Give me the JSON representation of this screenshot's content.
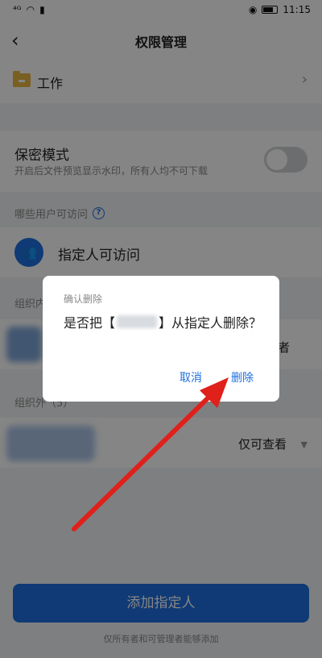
{
  "status_bar": {
    "signal": "⁴ᴳ",
    "time": "11:15"
  },
  "header": {
    "title": "权限管理"
  },
  "folder": {
    "name": "工作"
  },
  "secret_mode": {
    "title": "保密模式",
    "description": "开启后文件预览显示水印，所有人均不可下载",
    "enabled": false
  },
  "access": {
    "label": "哪些用户可访问",
    "option": "指定人可访问"
  },
  "sections": {
    "internal_label": "组织内",
    "internal_perm_partial": "者",
    "external_label": "组织外（5）",
    "external_perm": "仅可查看"
  },
  "bottom": {
    "add_button": "添加指定人",
    "note": "仅所有者和可管理者能够添加"
  },
  "dialog": {
    "title": "确认删除",
    "message_prefix": "是否把【",
    "message_suffix": "】从指定人删除？",
    "cancel": "取消",
    "delete": "删除"
  },
  "colors": {
    "accent": "#1e6fe0",
    "arrow": "#e0201b"
  }
}
